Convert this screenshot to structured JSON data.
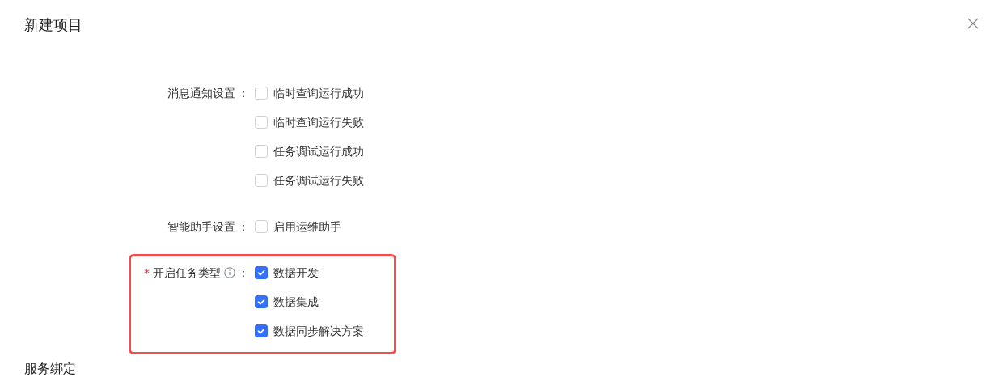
{
  "dialog": {
    "title": "新建项目"
  },
  "settings": [
    {
      "label": "消息通知设置",
      "colon": "：",
      "info": false,
      "highlighted": false,
      "options": [
        {
          "label": "临时查询运行成功",
          "checked": false
        },
        {
          "label": "临时查询运行失败",
          "checked": false
        },
        {
          "label": "任务调试运行成功",
          "checked": false
        },
        {
          "label": "任务调试运行失败",
          "checked": false
        }
      ]
    },
    {
      "label": "智能助手设置",
      "colon": "：",
      "info": false,
      "highlighted": false,
      "options": [
        {
          "label": "启用运维助手",
          "checked": false
        }
      ]
    },
    {
      "label": "开启任务类型",
      "colon": "：",
      "required": true,
      "required_mark": "*",
      "info": true,
      "highlighted": true,
      "options": [
        {
          "label": "数据开发",
          "checked": true
        },
        {
          "label": "数据集成",
          "checked": true
        },
        {
          "label": "数据同步解决方案",
          "checked": true
        }
      ]
    }
  ],
  "section_title": "服务绑定"
}
